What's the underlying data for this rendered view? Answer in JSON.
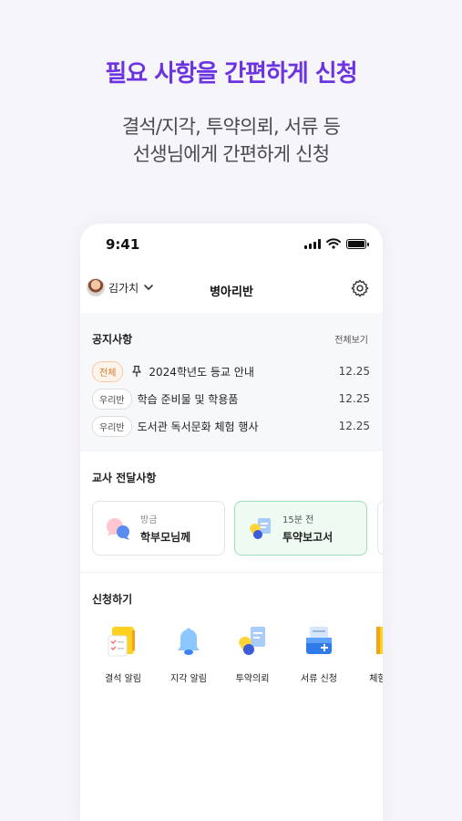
{
  "promo": {
    "headline": "필요 사항을 간편하게 신청",
    "subline1": "결석/지각, 투약의뢰, 서류 등",
    "subline2": "선생님에게 간편하게 신청"
  },
  "status_bar": {
    "time": "9:41"
  },
  "header": {
    "user_name": "김가치",
    "class_name": "병아리반"
  },
  "notice": {
    "title": "공지사항",
    "view_all": "전체보기",
    "items": [
      {
        "tag": "전체",
        "title": "2024학년도 등교 안내",
        "date": "12.25",
        "pinned": true
      },
      {
        "tag": "우리반",
        "title": "학습 준비물 및 학용품",
        "date": "12.25",
        "pinned": false
      },
      {
        "tag": "우리반",
        "title": "도서관 독서문화 체험 행사",
        "date": "12.25",
        "pinned": false
      }
    ]
  },
  "teacher_messages": {
    "title": "교사 전달사항",
    "cards": [
      {
        "when": "방금",
        "what": "학부모님께",
        "icon": "speech-bubbles-icon"
      },
      {
        "when": "15분 전",
        "what": "투약보고서",
        "icon": "medicine-report-icon",
        "highlighted": true
      }
    ]
  },
  "apply": {
    "title": "신청하기",
    "items": [
      {
        "label": "결석 알림",
        "icon": "checklist-icon"
      },
      {
        "label": "지각 알림",
        "icon": "bell-icon"
      },
      {
        "label": "투약의뢰",
        "icon": "medicine-icon"
      },
      {
        "label": "서류 신청",
        "icon": "document-tray-icon"
      },
      {
        "label": "체험학",
        "icon": "folder-icon"
      }
    ]
  },
  "colors": {
    "brand_purple": "#6c33e0",
    "tag_all_orange": "#d87a2c",
    "active_card_green": "#eefaf2"
  }
}
